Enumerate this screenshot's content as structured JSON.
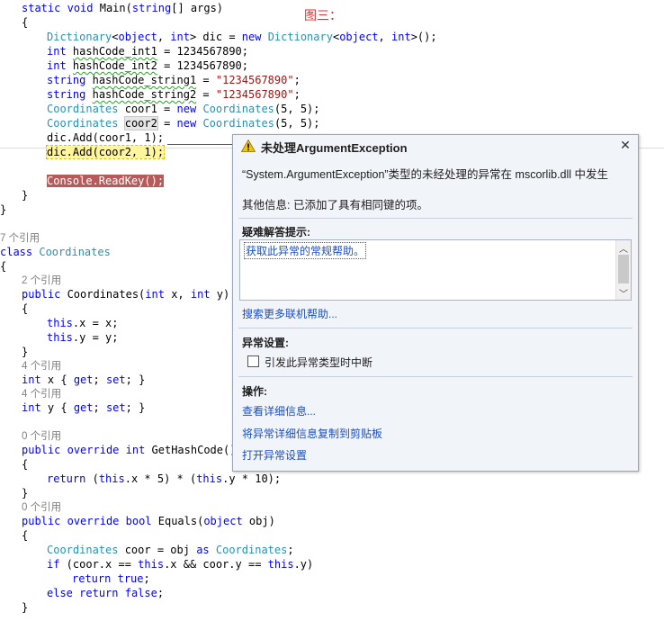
{
  "figure_label": "图三：",
  "code_lines": [
    {
      "t": 13,
      "l": 24,
      "html": "<span class='kw'>static</span> <span class='kw'>void</span> Main(<span class='kw'>string</span>[] args)"
    },
    {
      "t": 29,
      "l": 24,
      "html": "{"
    },
    {
      "t": 45,
      "l": 52,
      "html": "<span class='ty'>Dictionary</span>&lt;<span class='kw'>object</span>, <span class='kw'>int</span>&gt; dic = <span class='kw'>new</span> <span class='ty'>Dictionary</span>&lt;<span class='kw'>object</span>, <span class='kw'>int</span>&gt;();"
    },
    {
      "t": 61,
      "l": 52,
      "html": "<span class='kw'>int</span> <span class='squig'>hashCode_int1</span> = 1234567890;"
    },
    {
      "t": 77,
      "l": 52,
      "html": "<span class='kw'>int</span> <span class='squig'>hashCode_int2</span> = 1234567890;"
    },
    {
      "t": 93,
      "l": 52,
      "html": "<span class='kw'>string</span> <span class='squig'>hashCode_string1</span> = <span class='st'>\"1234567890\"</span>;"
    },
    {
      "t": 109,
      "l": 52,
      "html": "<span class='kw'>string</span> <span class='squig'>hashCode_string2</span> = <span class='st'>\"1234567890\"</span>;"
    },
    {
      "t": 125,
      "l": 52,
      "html": "<span class='ty'>Coordinates</span> coor1 = <span class='kw'>new</span> <span class='ty'>Coordinates</span>(5, 5);"
    },
    {
      "t": 141,
      "l": 52,
      "html": "<span class='ty'>Coordinates</span> <span class='hl-box'>coor2</span> = <span class='kw'>new</span> <span class='ty'>Coordinates</span>(5, 5);"
    },
    {
      "t": 157,
      "l": 52,
      "html": "dic.Add(coor1, 1);"
    },
    {
      "t": 173,
      "l": 52,
      "html": "<span class='hl-yellow'>dic.Add(coor2, 1);</span>"
    },
    {
      "t": 205,
      "l": 52,
      "html": "<span class='hl-err'><span class='ty'>Console</span>.ReadKey();</span>"
    },
    {
      "t": 221,
      "l": 24,
      "html": "}"
    },
    {
      "t": 237,
      "l": 0,
      "html": "}"
    },
    {
      "t": 268,
      "l": 0,
      "html": "<span class='ref'>7 个引用</span>"
    },
    {
      "t": 284,
      "l": 0,
      "html": "<span class='kw'>class</span> <span class='ty'>Coordinates</span>"
    },
    {
      "t": 300,
      "l": 0,
      "html": "{"
    },
    {
      "t": 315,
      "l": 24,
      "html": "<span class='ref'>2 个引用</span>"
    },
    {
      "t": 331,
      "l": 24,
      "html": "<span class='kw'>public</span> Coordinates(<span class='kw'>int</span> x, <span class='kw'>int</span> y)"
    },
    {
      "t": 347,
      "l": 24,
      "html": "{"
    },
    {
      "t": 363,
      "l": 52,
      "html": "<span class='kw'>this</span>.x = x;"
    },
    {
      "t": 379,
      "l": 52,
      "html": "<span class='kw'>this</span>.y = y;"
    },
    {
      "t": 395,
      "l": 24,
      "html": "}"
    },
    {
      "t": 410,
      "l": 24,
      "html": "<span class='ref'>4 个引用</span>"
    },
    {
      "t": 426,
      "l": 24,
      "html": "<span class='kw'>int</span> x { <span class='kw'>get</span>; <span class='kw'>set</span>; }"
    },
    {
      "t": 441,
      "l": 24,
      "html": "<span class='ref'>4 个引用</span>"
    },
    {
      "t": 457,
      "l": 24,
      "html": "<span class='kw'>int</span> y { <span class='kw'>get</span>; <span class='kw'>set</span>; }"
    },
    {
      "t": 488,
      "l": 24,
      "html": "<span class='ref'>0 个引用</span>"
    },
    {
      "t": 504,
      "l": 24,
      "html": "<span class='kw'>public</span> <span class='kw'>override</span> <span class='kw'>int</span> GetHashCode()"
    },
    {
      "t": 520,
      "l": 24,
      "html": "{"
    },
    {
      "t": 536,
      "l": 52,
      "html": "<span class='kw'>return</span> (<span class='kw'>this</span>.x * 5) * (<span class='kw'>this</span>.y * 10);"
    },
    {
      "t": 552,
      "l": 24,
      "html": "}"
    },
    {
      "t": 567,
      "l": 24,
      "html": "<span class='ref'>0 个引用</span>"
    },
    {
      "t": 583,
      "l": 24,
      "html": "<span class='kw'>public</span> <span class='kw'>override</span> <span class='kw'>bool</span> Equals(<span class='kw'>object</span> obj)"
    },
    {
      "t": 599,
      "l": 24,
      "html": "{"
    },
    {
      "t": 615,
      "l": 52,
      "html": "<span class='ty'>Coordinates</span> coor = obj <span class='kw'>as</span> <span class='ty'>Coordinates</span>;"
    },
    {
      "t": 631,
      "l": 52,
      "html": "<span class='kw'>if</span> (coor.x == <span class='kw'>this</span>.x &amp;&amp; coor.y == <span class='kw'>this</span>.y)"
    },
    {
      "t": 647,
      "l": 80,
      "html": "<span class='kw'>return</span> <span class='kw'>true</span>;"
    },
    {
      "t": 663,
      "l": 52,
      "html": "<span class='kw'>else</span> <span class='kw'>return</span> <span class='kw'>false</span>;"
    },
    {
      "t": 679,
      "l": 24,
      "html": "}"
    }
  ],
  "popup": {
    "title": "未处理ArgumentException",
    "close_icon": "close-icon",
    "warning_icon": "warning-icon",
    "message": "“System.ArgumentException”类型的未经处理的异常在 mscorlib.dll 中发生",
    "other_info": "其他信息: 已添加了具有相同键的项。",
    "tips_header": "疑难解答提示:",
    "tips_link": "获取此异常的常规帮助。",
    "search_link": "搜索更多联机帮助...",
    "exception_settings_header": "异常设置:",
    "checkbox_label": "引发此异常类型时中断",
    "checkbox_checked": false,
    "actions_header": "操作:",
    "actions": [
      "查看详细信息...",
      "将异常详细信息复制到剪贴板",
      "打开异常设置"
    ]
  },
  "colors": {
    "keyword": "#0000ff",
    "type": "#2b91af",
    "string": "#a31515",
    "error_highlight": "#b85a5a",
    "link": "#1a4fbf"
  }
}
